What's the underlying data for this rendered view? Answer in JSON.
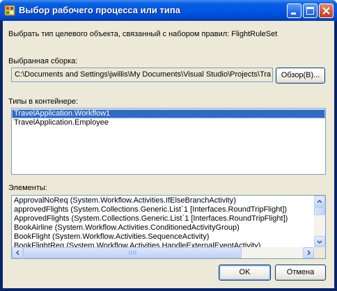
{
  "window": {
    "title": "Выбор рабочего процесса или типа"
  },
  "prompt": "Выбрать тип целевого объекта, связанный с набором правил: FlightRuleSet",
  "assembly": {
    "label": "Выбранная сборка:",
    "path": "C:\\Documents and Settings\\jwillis\\My Documents\\Visual Studio\\Projects\\Tra",
    "browse_label": "Обзор(B)..."
  },
  "types": {
    "label": "Типы в контейнере:",
    "items": [
      "TravelApplication.Workflow1",
      "TravelApplication.Employee"
    ],
    "selected_index": 0
  },
  "members": {
    "label": "Элементы:",
    "items": [
      "ApprovalNoReq   (System.Workflow.Activities.IfElseBranchActivity)",
      "approvedFlights   (System.Collections.Generic.List`1 [Interfaces.RoundTripFlight])",
      "ApprovedFlights   (System.Collections.Generic.List`1 [Interfaces.RoundTripFlight])",
      "BookAirline    (System.Workflow.Activities.ConditionedActivityGroup)",
      "BookFlight     (System.Workflow.Activities.SequenceActivity)",
      "BookFlightReq    (System.Workflow.Activities.HandleExternalEventActivity)"
    ]
  },
  "buttons": {
    "ok": "OK",
    "cancel": "Отмена"
  }
}
